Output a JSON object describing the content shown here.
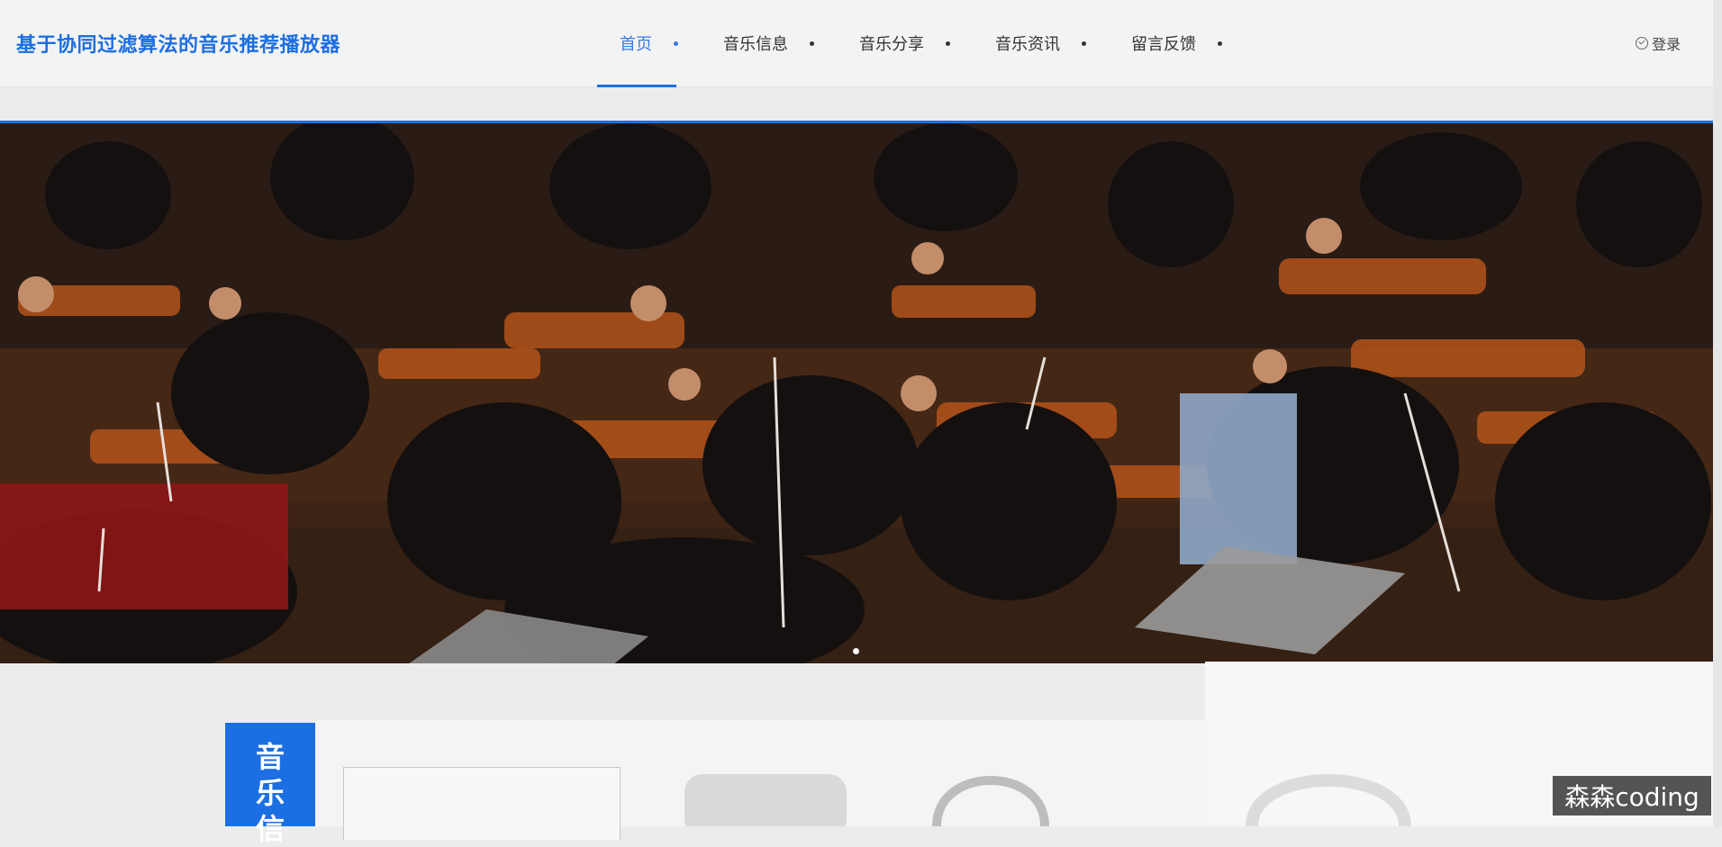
{
  "header": {
    "brand": "基于协同过滤算法的音乐推荐播放器",
    "nav": [
      {
        "label": "首页",
        "active": true
      },
      {
        "label": "音乐信息",
        "active": false
      },
      {
        "label": "音乐分享",
        "active": false
      },
      {
        "label": "音乐资讯",
        "active": false
      },
      {
        "label": "留言反馈",
        "active": false
      }
    ],
    "login_label": "登录"
  },
  "banner": {
    "image_desc_icon": "orchestra-photo",
    "slide_count": 1,
    "active_slide": 1
  },
  "section": {
    "tag_chars": [
      "音",
      "乐",
      "信"
    ]
  },
  "watermark": "森森coding",
  "colors": {
    "accent": "#1c6fe2",
    "header_bg": "#f3f3f3"
  }
}
